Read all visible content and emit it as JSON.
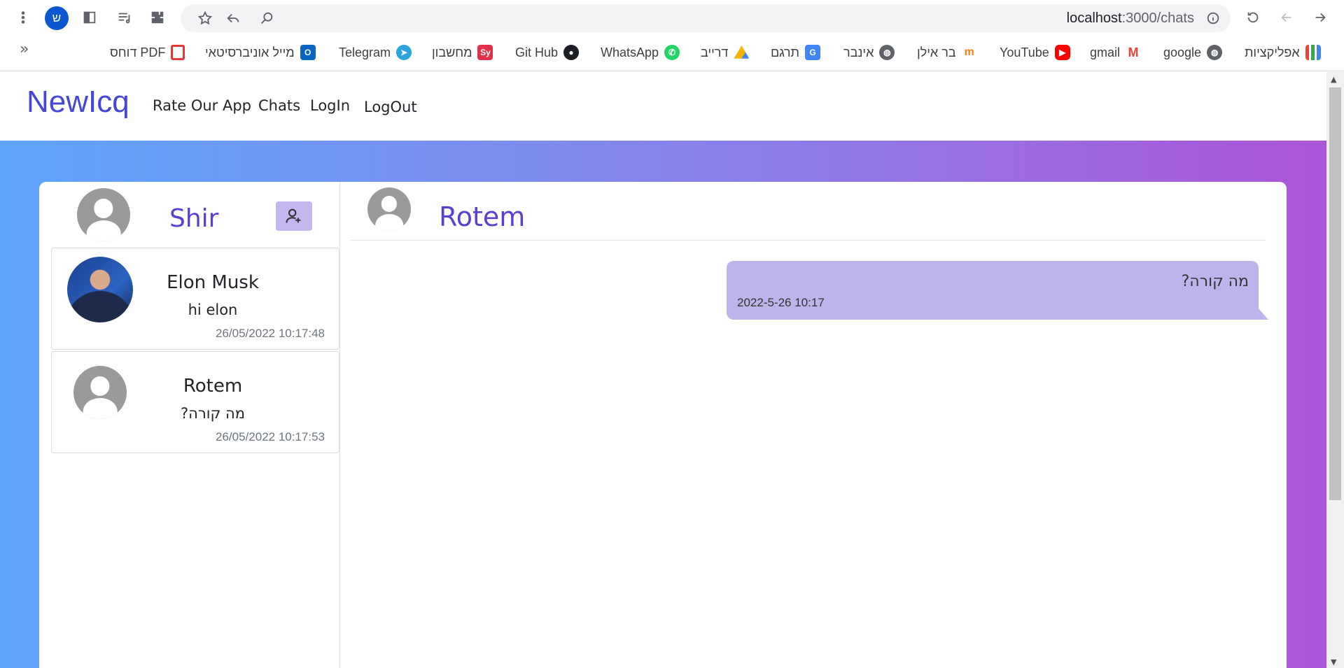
{
  "browser": {
    "profile_initial": "ש",
    "url_host": "localhost",
    "url_path": ":3000/chats"
  },
  "bookmarks": [
    {
      "label": "אפליקציות",
      "icon": "apps-grid-icon"
    },
    {
      "label": "google",
      "icon": "globe-icon"
    },
    {
      "label": "gmail",
      "icon": "gmail-icon"
    },
    {
      "label": "YouTube",
      "icon": "youtube-icon"
    },
    {
      "label": "בר אילן",
      "icon": "moodle-icon"
    },
    {
      "label": "אינבר",
      "icon": "globe-icon"
    },
    {
      "label": "תרגם",
      "icon": "translate-icon"
    },
    {
      "label": "דרייב",
      "icon": "drive-icon"
    },
    {
      "label": "WhatsApp",
      "icon": "whatsapp-icon"
    },
    {
      "label": "Git Hub",
      "icon": "github-icon"
    },
    {
      "label": "מחשבון",
      "icon": "calculator-icon"
    },
    {
      "label": "Telegram",
      "icon": "telegram-icon"
    },
    {
      "label": "מייל אוניברסיטאי",
      "icon": "outlook-icon"
    },
    {
      "label": "דוחס PDF",
      "icon": "pdf-icon"
    }
  ],
  "navbar": {
    "brand": "NewIcq",
    "links": [
      "Rate Our App",
      "Chats",
      "LogIn",
      "LogOut"
    ]
  },
  "sidebar": {
    "current_user": "Shir",
    "contacts": [
      {
        "name": "Elon Musk",
        "last_message": "hi elon",
        "time": "26/05/2022 10:17:48"
      },
      {
        "name": "Rotem",
        "last_message": "מה קורה?",
        "time": "26/05/2022 10:17:53"
      }
    ]
  },
  "chat": {
    "peer_name": "Rotem",
    "messages": [
      {
        "text": "מה קורה?",
        "time": "2022-5-26 10:17"
      }
    ]
  }
}
